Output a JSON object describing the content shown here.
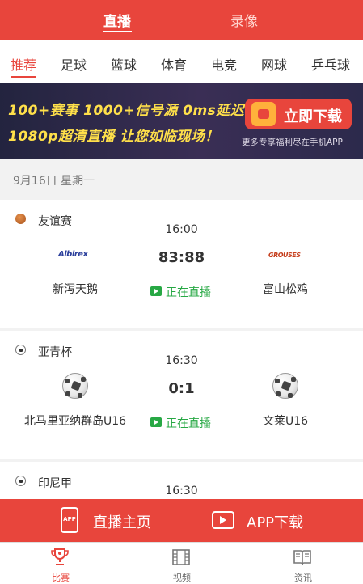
{
  "top_tabs": {
    "live": "直播",
    "replay": "录像"
  },
  "categories": [
    "推荐",
    "足球",
    "篮球",
    "体育",
    "电竞",
    "网球",
    "乒乓球"
  ],
  "banner": {
    "line1": "100+赛事 1000+信号源 0ms延迟",
    "line2": "1080p超清直播  让您如临现场！",
    "download_label": "立即下载",
    "sub": "更多专享福利尽在手机APP"
  },
  "date": "9月16日 星期一",
  "matches": [
    {
      "league": "友谊赛",
      "time": "16:00",
      "score": "83:88",
      "status": "正在直播",
      "home": "新泻天鹅",
      "away": "富山松鸡",
      "home_logo_text": "Albirex",
      "away_logo_text": "GROUSES"
    },
    {
      "league": "亚青杯",
      "time": "16:30",
      "score": "0:1",
      "status": "正在直播",
      "home": "北马里亚纳群岛U16",
      "away": "文莱U16"
    },
    {
      "league": "印尼甲",
      "time": "16:30"
    }
  ],
  "bottom_bar": {
    "home_label": "直播主页",
    "app_label": "APP下载",
    "app_icon_text": "APP"
  },
  "nav": {
    "matches": "比赛",
    "video": "视频",
    "news": "资讯"
  },
  "colors": {
    "accent": "#e8453c",
    "live_green": "#27a844"
  }
}
